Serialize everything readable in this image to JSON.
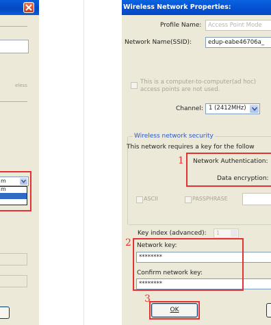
{
  "right_window": {
    "title": "Wireless Network Properties:",
    "profile_name_label": "Profile Name:",
    "profile_name_value": "Access Point Mode",
    "ssid_label": "Network Name(SSID):",
    "ssid_value": "edup-eabe46706a_",
    "adhoc_text_line1": "This is a computer-to-computer(ad hoc)",
    "adhoc_text_line2": "access points are not used.",
    "channel_label": "Channel:",
    "channel_value": "1  (2412MHz)",
    "security_group_label": "Wireless network security",
    "security_intro": "This network requires a key for the follow",
    "network_auth_label": "Network Authentication:",
    "data_encryption_label": "Data encryption:",
    "ascii_label": "ASCII",
    "passphrase_label": "PASSPHRASE",
    "key_index_label": "Key index (advanced):",
    "key_index_value": "1",
    "network_key_label": "Network key:",
    "network_key_value": "********",
    "confirm_key_label": "Confirm network key:",
    "confirm_key_value": "********",
    "ok_label": "OK"
  },
  "left_window": {
    "faint_text": "eless",
    "dropdown_value": "m",
    "dropdown_options": [
      "m"
    ]
  },
  "annotations": {
    "marker_1": "1",
    "marker_2": "2",
    "marker_3": "3",
    "color": "#e63030"
  },
  "colors": {
    "titlebar": "#0553d4",
    "window_bg": "#ece9d8",
    "group_label": "#2a55c8",
    "selection": "#316ac5"
  }
}
